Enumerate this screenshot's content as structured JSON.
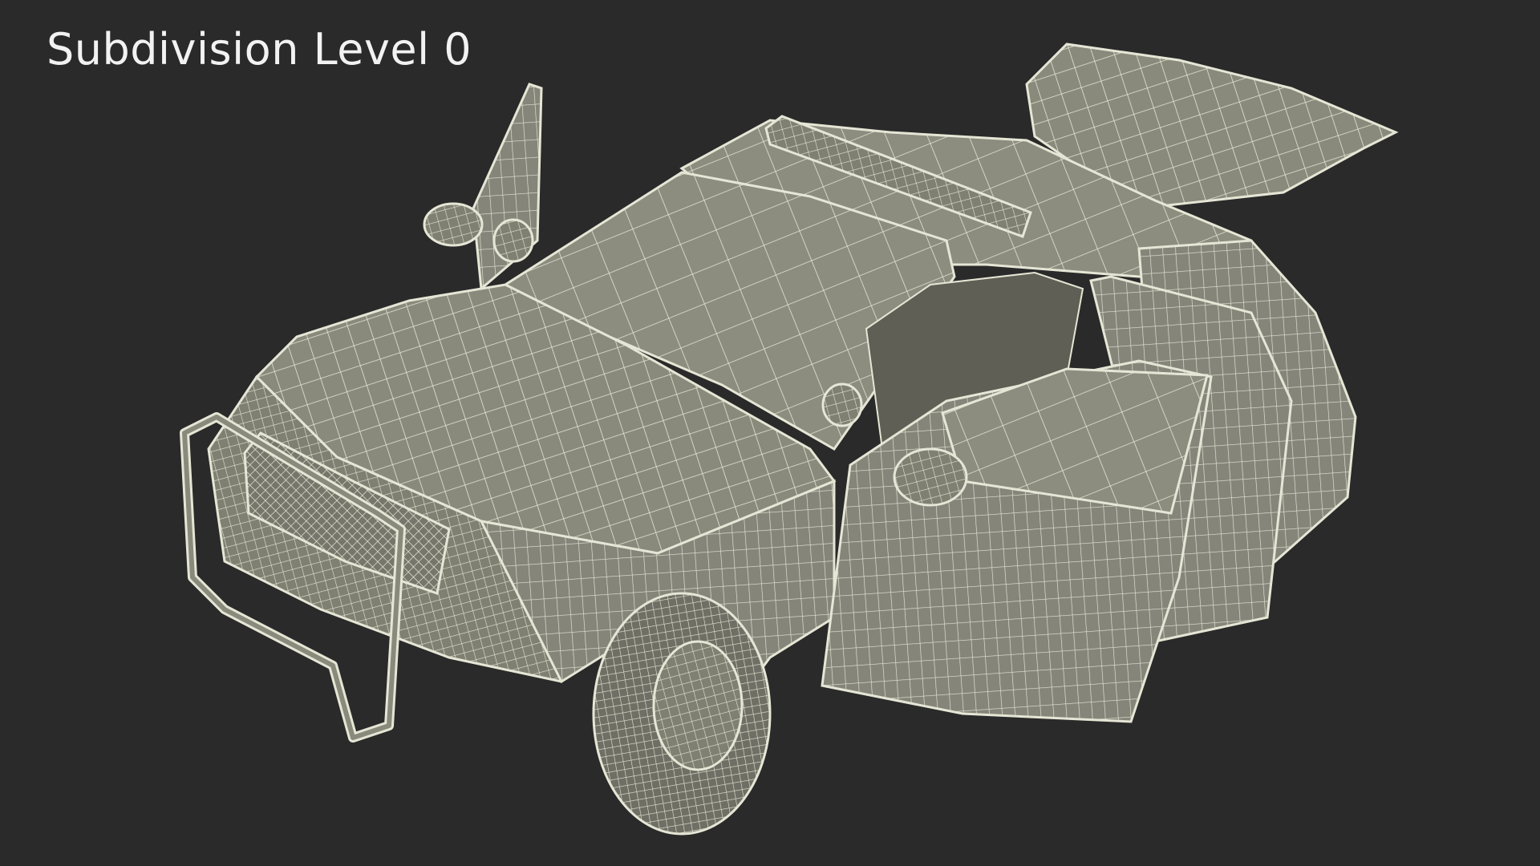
{
  "scene": {
    "caption": "Subdivision Level 0",
    "background_color": "#2a2a2a",
    "model_fill_color": "#8a8a7c",
    "wire_color": "#e6e6d6",
    "shadow_color": "#5f5f55"
  }
}
